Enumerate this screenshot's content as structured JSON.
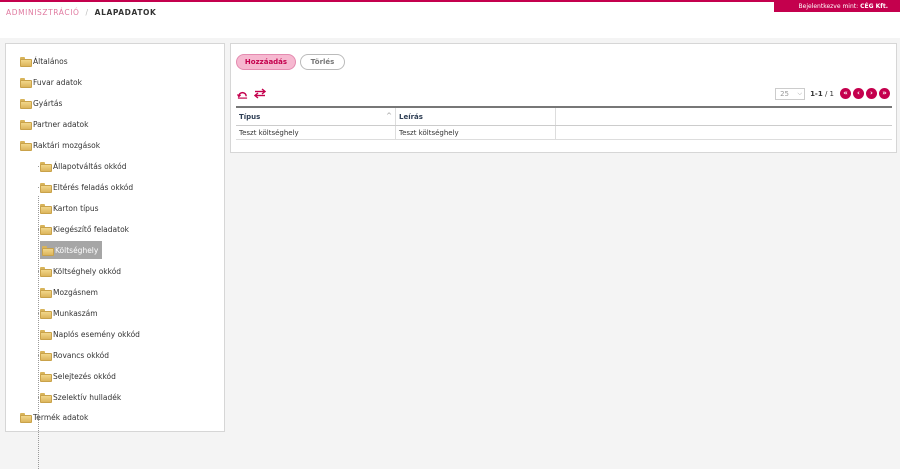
{
  "header": {
    "crumb_root": "ADMINISZTRÁCIÓ",
    "crumb_separator": "/",
    "crumb_current": "ALAPADATOK",
    "login_label": "Bejelentkezve mint:",
    "login_company": "CÉG Kft.",
    "accent_color": "#c4004d"
  },
  "tree": {
    "items": [
      {
        "label": "Általános",
        "icon": "folder-icon",
        "level": 0
      },
      {
        "label": "Fuvar adatok",
        "icon": "folder-icon",
        "level": 0
      },
      {
        "label": "Gyártás",
        "icon": "folder-icon",
        "level": 0
      },
      {
        "label": "Partner adatok",
        "icon": "folder-icon",
        "level": 0
      },
      {
        "label": "Raktári mozgások",
        "icon": "folder-icon",
        "level": 0
      },
      {
        "label": "Állapotváltás okkód",
        "icon": "folder-icon",
        "level": 1
      },
      {
        "label": "Eltérés feladás okkód",
        "icon": "folder-icon",
        "level": 1
      },
      {
        "label": "Karton típus",
        "icon": "folder-icon",
        "level": 1
      },
      {
        "label": "Kiegészítő feladatok",
        "icon": "folder-icon",
        "level": 1
      },
      {
        "label": "Költséghely",
        "icon": "folder-icon",
        "level": 1,
        "selected": true
      },
      {
        "label": "Költséghely okkód",
        "icon": "folder-icon",
        "level": 1
      },
      {
        "label": "Mozgásnem",
        "icon": "folder-icon",
        "level": 1
      },
      {
        "label": "Munkaszám",
        "icon": "folder-icon",
        "level": 1
      },
      {
        "label": "Naplós esemény okkód",
        "icon": "folder-icon",
        "level": 1
      },
      {
        "label": "Rovancs okkód",
        "icon": "folder-icon",
        "level": 1
      },
      {
        "label": "Selejtezés okkód",
        "icon": "folder-icon",
        "level": 1
      },
      {
        "label": "Szelektív hulladék",
        "icon": "folder-icon",
        "level": 1
      },
      {
        "label": "Termék adatok",
        "icon": "folder-icon",
        "level": 0
      }
    ]
  },
  "toolbar": {
    "add_label": "Hozzáadás",
    "delete_label": "Törlés",
    "refresh_icon": "refresh-icon",
    "swap_icon": "swap-icon"
  },
  "pager": {
    "page_size": "25",
    "range": "1-1",
    "of_text": "/ 1",
    "buttons": [
      "first-page-icon",
      "prev-page-icon",
      "next-page-icon",
      "last-page-icon"
    ]
  },
  "grid": {
    "columns": [
      "Típus",
      "Leírás",
      ""
    ],
    "rows": [
      [
        "Teszt költséghely",
        "Teszt költséghely",
        ""
      ]
    ]
  }
}
